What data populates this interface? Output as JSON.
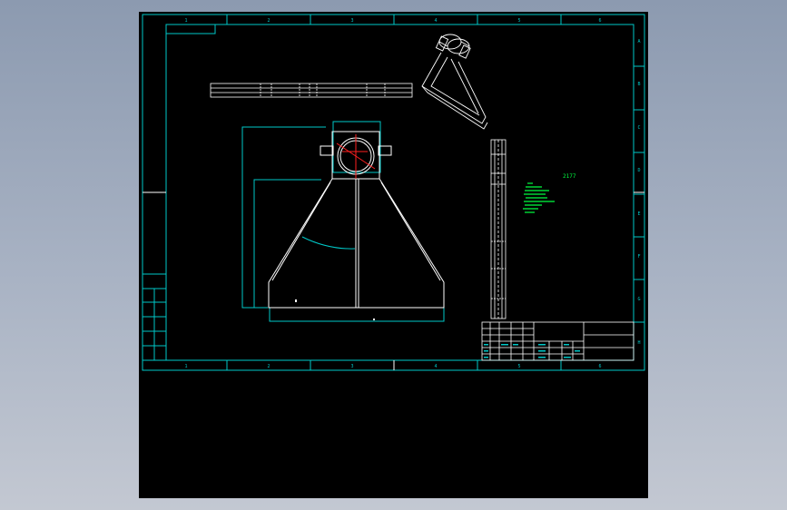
{
  "viewer": {
    "background_color": "#000000",
    "frame_color": "#00c8c8",
    "line_color": "#ffffff",
    "centerline_color": "#ff2020",
    "note_color": "#00ff40"
  },
  "zone_labels": {
    "top": [
      "1",
      "2",
      "3",
      "4",
      "5",
      "6"
    ],
    "bottom": [
      "1",
      "2",
      "3",
      "4",
      "5",
      "6"
    ],
    "right": [
      "A",
      "B",
      "C",
      "D",
      "E",
      "F",
      "G",
      "H"
    ]
  },
  "notes": {
    "label": "2177"
  },
  "title_block": {
    "rows": 4,
    "columns": 6
  }
}
